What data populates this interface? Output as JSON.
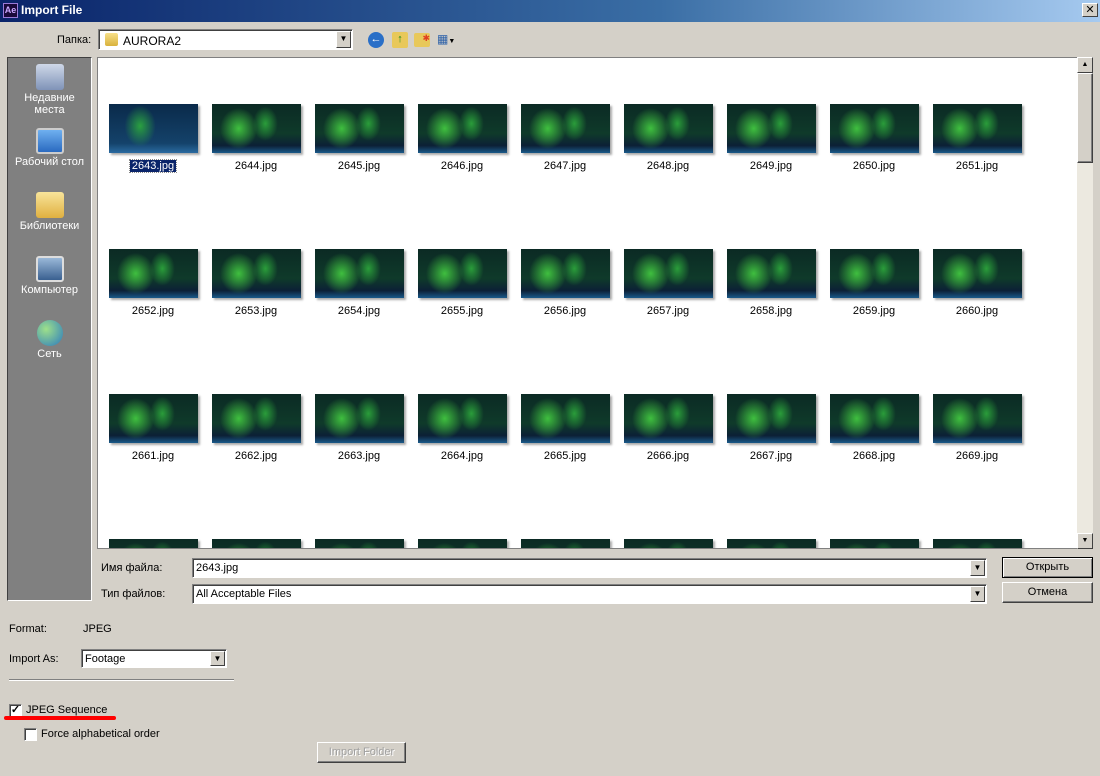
{
  "window": {
    "title": "Import File",
    "app_badge": "Ae"
  },
  "toolbar": {
    "folder_label": "Папка:",
    "folder_value": "AURORA2",
    "icons": [
      "back-icon",
      "up-folder-icon",
      "new-folder-icon",
      "view-menu-icon"
    ]
  },
  "sidebar": {
    "items": [
      {
        "label": "Недавние места",
        "icon": "recent-places-icon"
      },
      {
        "label": "Рабочий стол",
        "icon": "desktop-icon"
      },
      {
        "label": "Библиотеки",
        "icon": "libraries-icon"
      },
      {
        "label": "Компьютер",
        "icon": "computer-icon"
      },
      {
        "label": "Сеть",
        "icon": "network-icon"
      }
    ]
  },
  "files": [
    "2643.jpg",
    "2644.jpg",
    "2645.jpg",
    "2646.jpg",
    "2647.jpg",
    "2648.jpg",
    "2649.jpg",
    "2650.jpg",
    "2651.jpg",
    "2652.jpg",
    "2653.jpg",
    "2654.jpg",
    "2655.jpg",
    "2656.jpg",
    "2657.jpg",
    "2658.jpg",
    "2659.jpg",
    "2660.jpg",
    "2661.jpg",
    "2662.jpg",
    "2663.jpg",
    "2664.jpg",
    "2665.jpg",
    "2666.jpg",
    "2667.jpg",
    "2668.jpg",
    "2669.jpg"
  ],
  "selected_file": "2643.jpg",
  "filename": {
    "label": "Имя файла:",
    "value": "2643.jpg"
  },
  "filetype": {
    "label": "Тип файлов:",
    "value": "All Acceptable Files"
  },
  "buttons": {
    "open": "Открыть",
    "cancel": "Отмена",
    "import_folder": "Import Folder"
  },
  "options": {
    "format_label": "Format:",
    "format_value": "JPEG",
    "import_as_label": "Import As:",
    "import_as_value": "Footage",
    "sequence_label": "JPEG Sequence",
    "sequence_checked": true,
    "force_alpha_label": "Force alphabetical order",
    "force_alpha_checked": false
  },
  "colors": {
    "annotation_underline": "#ff0000",
    "selection": "#0a246a"
  }
}
